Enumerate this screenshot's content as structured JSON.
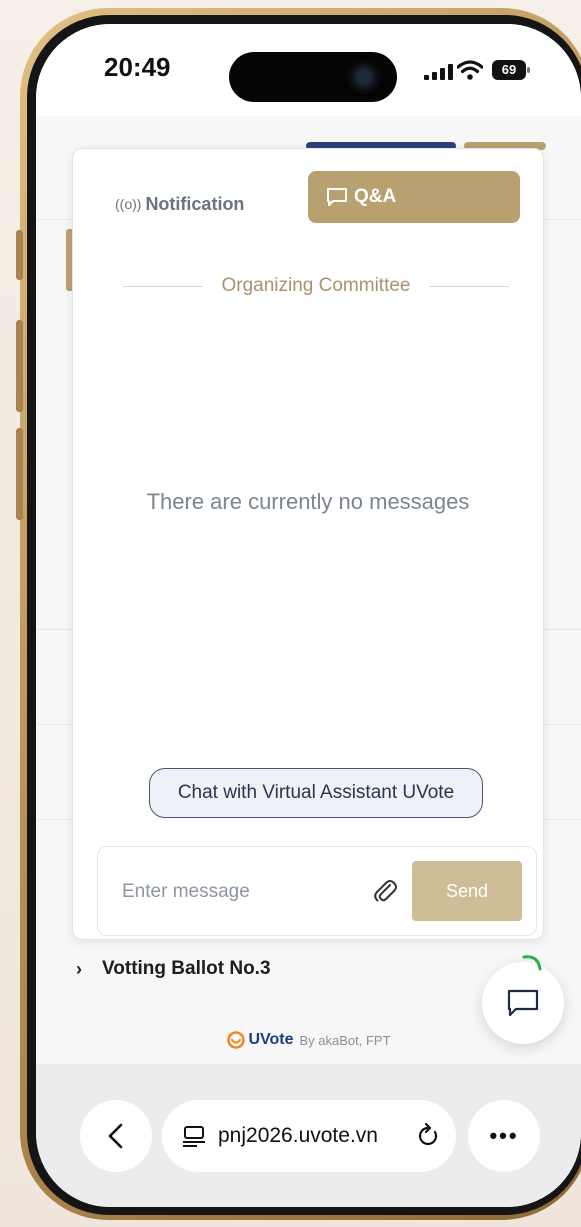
{
  "status_bar": {
    "time": "20:49",
    "battery": "69"
  },
  "chat": {
    "tabs": [
      {
        "label": "Notification",
        "active": false
      },
      {
        "label": "Q&A",
        "active": true
      }
    ],
    "section_label": "Organizing Committee",
    "empty_message": "There are currently no messages",
    "assistant_button_label": "Chat with Virtual Assistant UVote",
    "input_placeholder": "Enter message",
    "send_label": "Send"
  },
  "ballot": {
    "label": "Votting Ballot No.3"
  },
  "branding": {
    "name": "UVote",
    "byline": "By akaBot, FPT"
  },
  "browser": {
    "url": "pnj2026.uvote.vn"
  },
  "icons": {
    "notification": "broadcast-icon",
    "qa": "chat-bubble-icon",
    "attach": "paperclip-icon",
    "fab": "chat-bubble-icon",
    "back": "chevron-left-icon",
    "tabs": "tab-icon",
    "reload": "reload-icon",
    "more": "more-icon"
  },
  "colors": {
    "accent_gold": "#b9a070",
    "send_disabled": "#cfbd98",
    "brand_blue": "#1f3d80",
    "brand_orange": "#f08a24",
    "online_green": "#2bb24c"
  }
}
